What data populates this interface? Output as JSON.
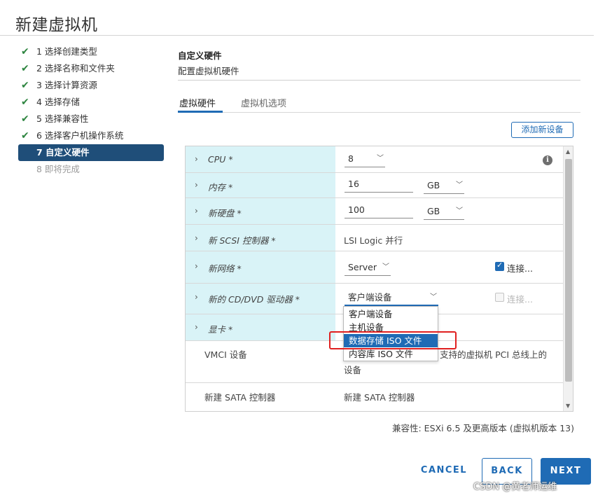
{
  "dialog": {
    "title": "新建虚拟机"
  },
  "steps": [
    {
      "label": "1 选择创建类型",
      "state": "done"
    },
    {
      "label": "2 选择名称和文件夹",
      "state": "done"
    },
    {
      "label": "3 选择计算资源",
      "state": "done"
    },
    {
      "label": "4 选择存储",
      "state": "done"
    },
    {
      "label": "5 选择兼容性",
      "state": "done"
    },
    {
      "label": "6 选择客户机操作系统",
      "state": "done"
    },
    {
      "label": "7 自定义硬件",
      "state": "active"
    },
    {
      "label": "8 即将完成",
      "state": "pending"
    }
  ],
  "section": {
    "title": "自定义硬件",
    "subtitle": "配置虚拟机硬件"
  },
  "tabs": {
    "hardware": "虚拟硬件",
    "options": "虚拟机选项"
  },
  "add_device": "添加新设备",
  "hardware": {
    "cpu": {
      "label": "CPU *",
      "value": "8"
    },
    "memory": {
      "label": "内存 *",
      "value": "16",
      "unit": "GB"
    },
    "disk": {
      "label": "新硬盘 *",
      "value": "100",
      "unit": "GB"
    },
    "scsi": {
      "label": "新 SCSI 控制器 *",
      "value": "LSI Logic 并行"
    },
    "network": {
      "label": "新网络 *",
      "value": "Server",
      "connect_label": "连接..."
    },
    "cdrom": {
      "label": "新的 CD/DVD 驱动器 *",
      "value": "客户端设备",
      "connect_label": "连接..."
    },
    "gpu": {
      "label": "显卡 *"
    },
    "vmci": {
      "label": "VMCI 设备",
      "value_line1": "支持的虚拟机 PCI 总线上的",
      "value_line2": "设备"
    },
    "sata": {
      "label": "新建 SATA 控制器",
      "value": "新建 SATA 控制器"
    }
  },
  "cdrom_dropdown": {
    "options": [
      "客户端设备",
      "主机设备",
      "数据存储 ISO 文件",
      "内容库 ISO 文件"
    ],
    "selected": "数据存储 ISO 文件"
  },
  "compatibility": "兼容性: ESXi 6.5 及更高版本 (虚拟机版本 13)",
  "buttons": {
    "cancel": "CANCEL",
    "back": "BACK",
    "next": "NEXT"
  },
  "watermark": "CSDN @黄老师运维",
  "colors": {
    "accent": "#1f6bb5",
    "nav_active": "#1f4e79",
    "check": "#2e8540",
    "highlight_row": "#d9f3f7",
    "annotation": "#e02020"
  }
}
